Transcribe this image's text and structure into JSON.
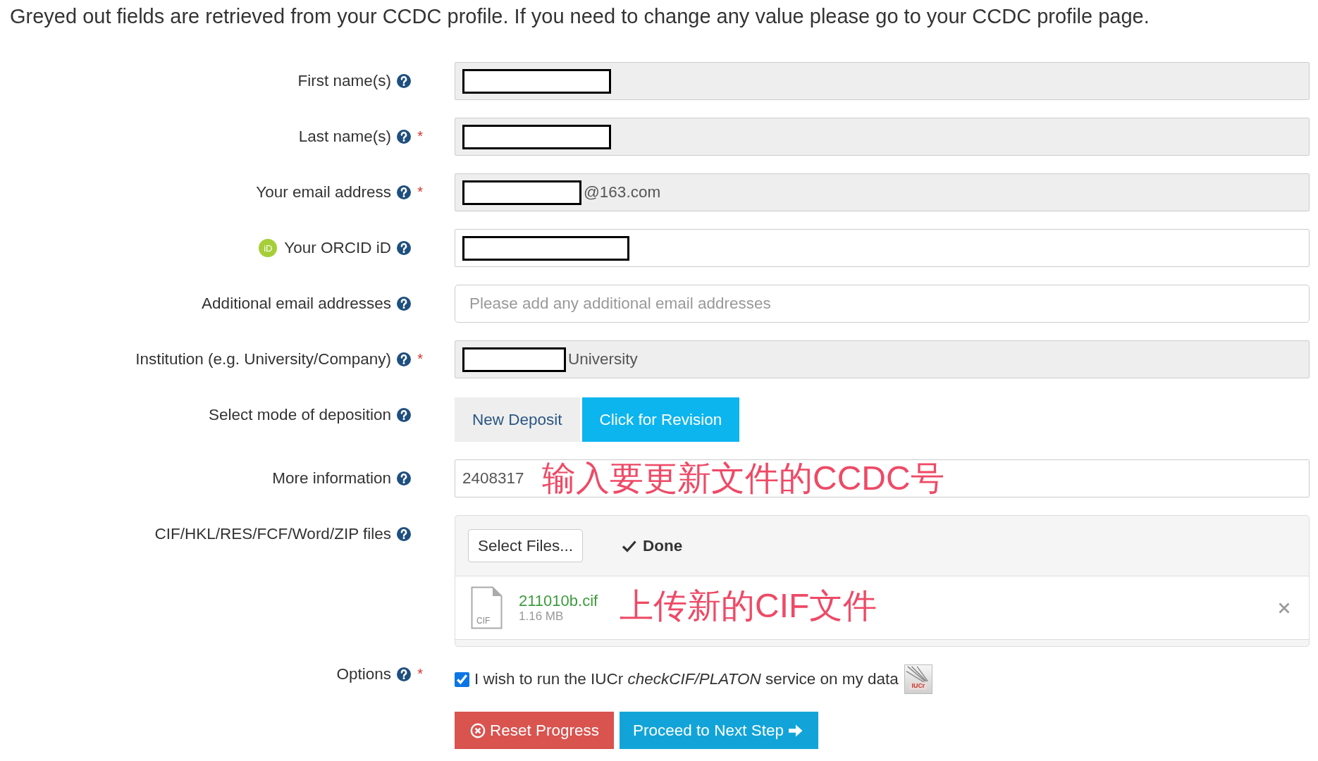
{
  "intro": "Greyed out fields are retrieved from your CCDC profile. If you need to change any value please go to your CCDC profile page.",
  "fields": [
    {
      "kind": "text",
      "label": "First name(s)",
      "disabled": true,
      "redacted": true
    },
    {
      "kind": "text",
      "label": "Last name(s)",
      "required_mark": "*",
      "disabled": true,
      "redacted": true
    },
    {
      "kind": "text",
      "label": "Your email address",
      "required_mark": "*",
      "disabled": true,
      "redacted": true,
      "value": "@163.com"
    },
    {
      "kind": "text",
      "label": "Your ORCID iD",
      "label_logo": "iD",
      "disabled": false,
      "redacted": true
    },
    {
      "kind": "text",
      "label": "Additional email addresses",
      "disabled": false,
      "placeholder": "Please add any additional email addresses"
    },
    {
      "kind": "text",
      "label": "Institution (e.g. University/Company)",
      "required_mark": "*",
      "disabled": true,
      "redacted": true,
      "value": "University"
    },
    {
      "kind": "toggle",
      "label": "Select mode of deposition",
      "options": [
        {
          "label": "New Deposit",
          "selected": false
        },
        {
          "label": "Click for Revision",
          "selected": true
        }
      ]
    },
    {
      "kind": "text",
      "label": "More information",
      "disabled": false,
      "value": "2408317",
      "annotation": "输入要更新文件的CCDC号"
    },
    {
      "kind": "upload",
      "label": "CIF/HKL/RES/FCF/Word/ZIP files",
      "button": "Select Files...",
      "status": "Done",
      "files": [
        {
          "type_label": "CIF",
          "name": "211010b.cif",
          "size": "1.16 MB"
        }
      ],
      "annotation": "上传新的CIF文件"
    },
    {
      "kind": "checkbox",
      "label": "Options",
      "required_mark": "*",
      "checked": true,
      "text": "I wish to run the IUCr *checkCIF/PLATON* service on my data",
      "service_logo": "IUCr"
    }
  ],
  "actions": [
    {
      "kind": "reset",
      "label": "Reset Progress"
    },
    {
      "kind": "proceed",
      "label": "Proceed to Next Step"
    }
  ]
}
